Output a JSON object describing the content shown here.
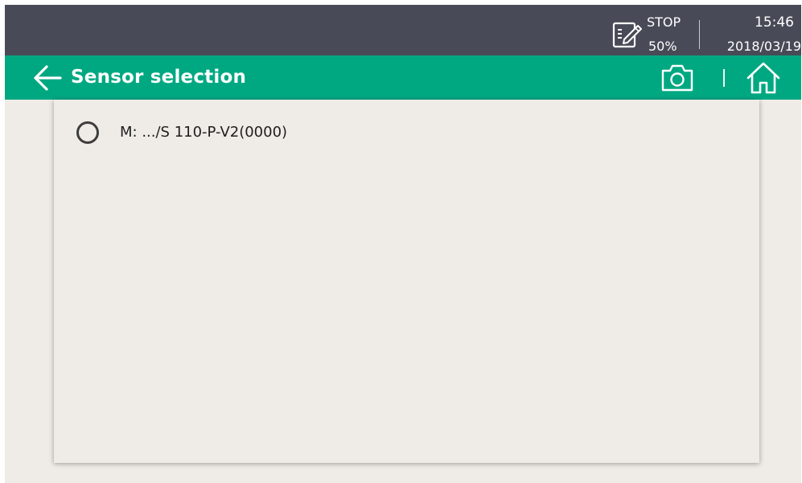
{
  "status": {
    "state": "STOP",
    "percent": "50%",
    "time": "15:46",
    "date": "2018/03/19",
    "icons": {
      "memo": "memo-pencil-icon"
    }
  },
  "titlebar": {
    "title": "Sensor selection",
    "icons": {
      "back": "arrow-left-icon",
      "camera": "camera-icon",
      "home": "home-icon"
    }
  },
  "sensors": [
    {
      "label": "M: .../S 110-P-V2(0000)",
      "selected": false
    }
  ],
  "colors": {
    "status_bar": "#484b57",
    "title_bar": "#00a882",
    "background": "#efece7"
  }
}
